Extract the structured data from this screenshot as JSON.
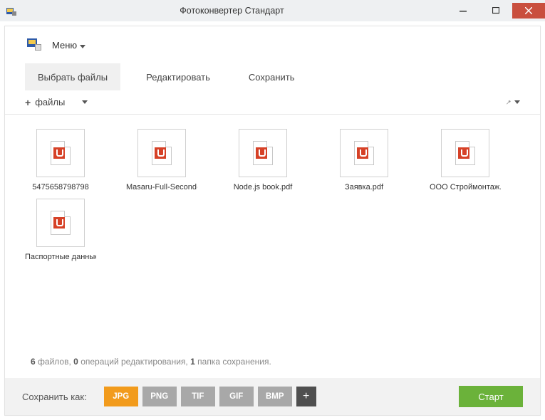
{
  "window": {
    "title": "Фотоконвертер Стандарт"
  },
  "menu": {
    "label": "Меню"
  },
  "tabs": [
    {
      "label": "Выбрать файлы",
      "active": true
    },
    {
      "label": "Редактировать",
      "active": false
    },
    {
      "label": "Сохранить",
      "active": false
    }
  ],
  "filesbar": {
    "add_label": "файлы"
  },
  "files": [
    {
      "name": "5475658798798"
    },
    {
      "name": "Masaru-Full-Second-Edition.pdf"
    },
    {
      "name": "Node.js book.pdf"
    },
    {
      "name": "Заявка.pdf"
    },
    {
      "name": "ООО Строймонтаж.pdf"
    },
    {
      "name": "Паспортные данные.pdf"
    }
  ],
  "status": {
    "count_files": "6",
    "files_word": "файлов,",
    "count_ops": "0",
    "ops_word": "операций редактирования,",
    "count_folders": "1",
    "folders_word": "папка сохранения."
  },
  "bottom": {
    "save_as": "Сохранить как:",
    "formats": [
      {
        "label": "JPG",
        "active": true
      },
      {
        "label": "PNG",
        "active": false
      },
      {
        "label": "TIF",
        "active": false
      },
      {
        "label": "GIF",
        "active": false
      },
      {
        "label": "BMP",
        "active": false
      }
    ],
    "add_format": "+",
    "start": "Старт"
  }
}
